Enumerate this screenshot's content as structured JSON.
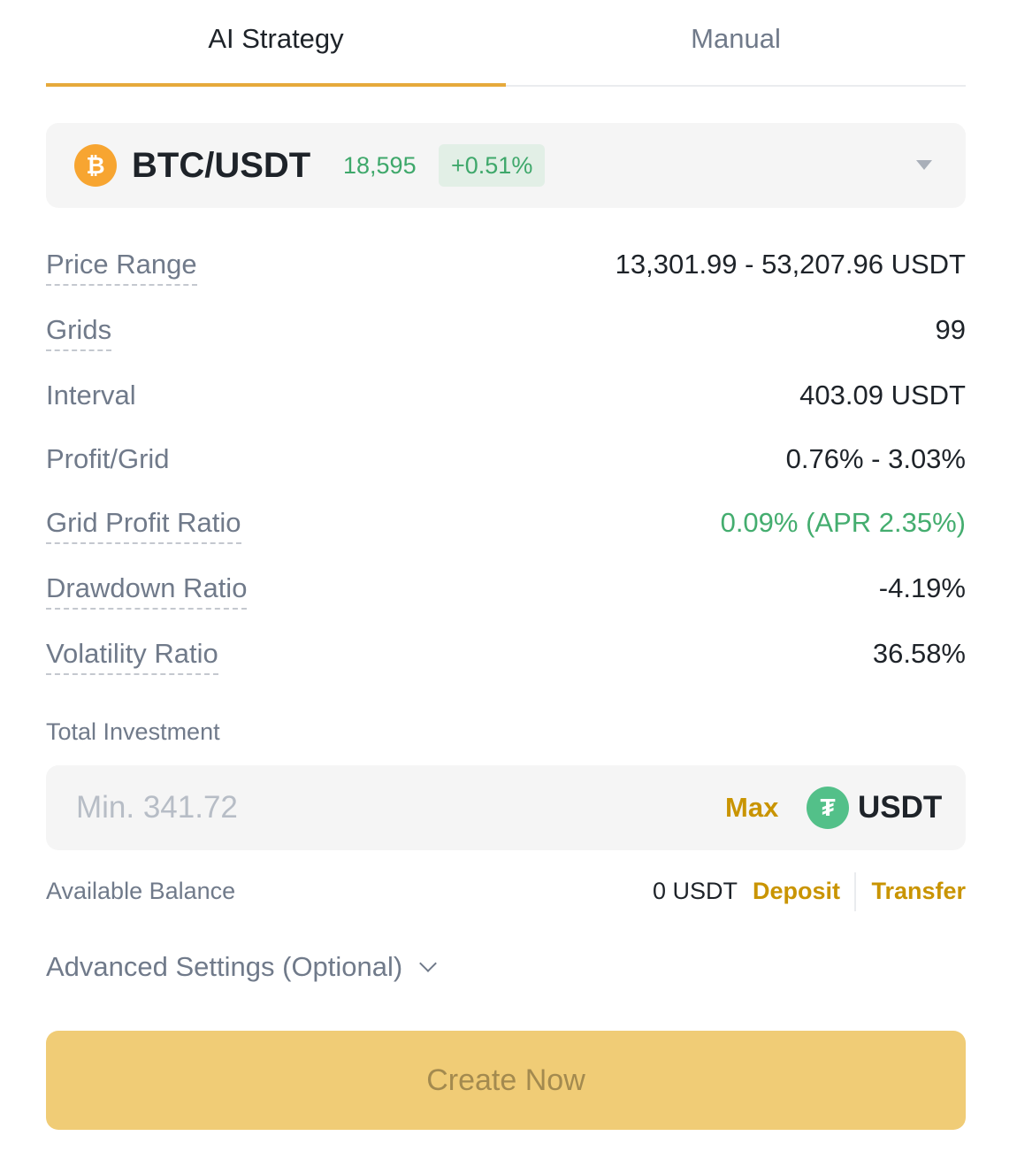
{
  "tabs": {
    "ai": "AI Strategy",
    "manual": "Manual"
  },
  "pair": {
    "coin_glyph": "₿",
    "name": "BTC/USDT",
    "price": "18,595",
    "change": "+0.51%"
  },
  "stats": [
    {
      "label": "Price Range",
      "value": "13,301.99 - 53,207.96 USDT"
    },
    {
      "label": "Grids",
      "value": "99"
    },
    {
      "label": "Interval",
      "value": "403.09 USDT"
    },
    {
      "label": "Profit/Grid",
      "value": "0.76% - 3.03%"
    },
    {
      "label": "Grid Profit Ratio",
      "value": "0.09% (APR 2.35%)"
    },
    {
      "label": "Drawdown Ratio",
      "value": "-4.19%"
    },
    {
      "label": "Volatility Ratio",
      "value": "36.58%"
    }
  ],
  "investment": {
    "label": "Total Investment",
    "placeholder": "Min. 341.72",
    "max_label": "Max",
    "currency_glyph": "₮",
    "currency": "USDT"
  },
  "balance": {
    "label": "Available Balance",
    "value": "0 USDT",
    "deposit": "Deposit",
    "transfer": "Transfer"
  },
  "advanced": "Advanced Settings (Optional)",
  "create_label": "Create Now",
  "colors": {
    "accent": "#e6a93b",
    "positive": "#44ad6f",
    "link": "#c99400",
    "button": "#f0cc76"
  }
}
